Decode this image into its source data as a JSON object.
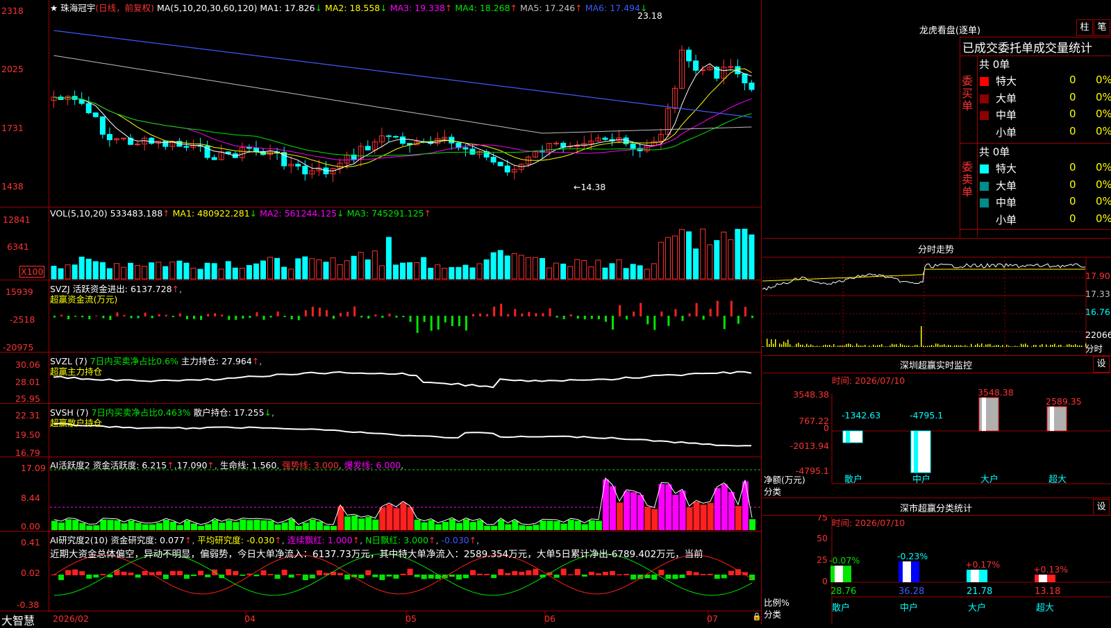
{
  "app": {
    "name": "大智慧"
  },
  "stock": {
    "star": "★",
    "name": "珠海冠宇",
    "mode": "(日线，前复权)"
  },
  "main": {
    "ma_label": "MA(5,10,20,30,60,120)",
    "ma": [
      {
        "label": "MA1:",
        "value": "17.826",
        "arrow": "↓",
        "color": "#ffffff"
      },
      {
        "label": "MA2:",
        "value": "18.558",
        "arrow": "↓",
        "color": "#ffff00"
      },
      {
        "label": "MA3:",
        "value": "19.338",
        "arrow": "↑",
        "color": "#ff00ff"
      },
      {
        "label": "MA4:",
        "value": "18.268",
        "arrow": "↑",
        "color": "#00e600"
      },
      {
        "label": "MA5:",
        "value": "17.246",
        "arrow": "↑",
        "color": "#c0c0c0"
      },
      {
        "label": "MA6:",
        "value": "17.494",
        "arrow": "↓",
        "color": "#3c5aff"
      }
    ],
    "y_ticks": [
      "2318",
      "2025",
      "1731",
      "1438"
    ],
    "high_note": "23.18",
    "low_note": "←14.38"
  },
  "vol": {
    "label": "VOL(5,10,20)",
    "value": "533483.188",
    "arrow": "↑",
    "ma": [
      {
        "label": "MA1:",
        "value": "480922.281",
        "arrow": "↓",
        "color": "#ffff00"
      },
      {
        "label": "MA2:",
        "value": "561244.125",
        "arrow": "↓",
        "color": "#ff00ff"
      },
      {
        "label": "MA3:",
        "value": "745291.125",
        "arrow": "↑",
        "color": "#00e600"
      }
    ],
    "y_ticks": [
      "12841",
      "6341",
      "X100"
    ]
  },
  "svzj": {
    "label": "SVZJ",
    "desc": "活跃资金进出:",
    "value": "6137.728",
    "arrow": "↑",
    "sub": "超赢资金流(万元)",
    "y_ticks": [
      "15939",
      "-2518",
      "-20975"
    ]
  },
  "svzl": {
    "label": "SVZL (7)",
    "desc": "7日内买卖净占比0.6%",
    "desc2": "主力持仓:",
    "value": "27.964",
    "arrow": "↑",
    "sub": "超赢主力持仓",
    "y_ticks": [
      "30.06",
      "28.01",
      "25.95"
    ]
  },
  "svsh": {
    "label": "SVSH (7)",
    "desc": "7日内买卖净占比0.463%",
    "desc2": "散户持仓:",
    "value": "17.255",
    "arrow": "↓",
    "sub": "超赢散户持仓",
    "y_ticks": [
      "22.31",
      "19.50",
      "16.79"
    ]
  },
  "ai1": {
    "label": "AI活跃度2",
    "desc": "资金活跃度:",
    "value": "6.215",
    "v2": "17.090",
    "life_label": "生命线:",
    "life": "1.560",
    "strong_label": "强势线:",
    "strong": "3.000",
    "burst_label": "爆发线:",
    "burst": "6.000",
    "y_ticks": [
      "17.09",
      "8.44",
      "0.00"
    ]
  },
  "ai2": {
    "label": "AI研究度2(10)",
    "desc": "资金研究度:",
    "value": "0.077",
    "avg_label": "平均研究度:",
    "avg": "-0.030",
    "lx_label": "连续飘红:",
    "lx": "1.000",
    "n_label": "N日飘红:",
    "n": "3.000",
    "last": "-0.030",
    "comment": "近期大资金总体偏空，异动不明显，偏弱势，今日大单净流入：6137.73万元，其中特大单净流入：2589.354万元，大单5日累计净出-6789.402万元，当前",
    "y_ticks": [
      "0.41",
      "0.02",
      "-0.38"
    ]
  },
  "xaxis": [
    "2026/02",
    "04",
    "05",
    "06",
    "07"
  ],
  "lhb": {
    "title": "龙虎看盘(逐单)",
    "btn_a": "柱",
    "btn_b": "笔",
    "header": "已成交委托单成交量统计",
    "buy_label": "委买单",
    "sell_label": "委卖单",
    "total": "共 0单",
    "rows": [
      {
        "name": "特大",
        "qty": "0",
        "pct": "0%"
      },
      {
        "name": "大单",
        "qty": "0",
        "pct": "0%"
      },
      {
        "name": "中单",
        "qty": "0",
        "pct": "0%"
      },
      {
        "name": "小单",
        "qty": "0",
        "pct": "0%"
      }
    ]
  },
  "fenshi": {
    "title": "分时走势",
    "y": [
      "17.90",
      "17.33",
      "16.76",
      "22066",
      "分时"
    ]
  },
  "monitor": {
    "title": "深圳超赢实时监控",
    "btn": "设",
    "time": "时间: 2026/07/10",
    "y": [
      "3548.38",
      "767.22",
      "0",
      "-2013.94",
      "-4795.1"
    ],
    "unit": "净额(万元)",
    "cat_label": "分类",
    "bars": [
      {
        "name": "散户",
        "value": -1342.63,
        "label": "-1342.63"
      },
      {
        "name": "中户",
        "value": -4795.1,
        "label": "-4795.1"
      },
      {
        "name": "大户",
        "value": 3548.38,
        "label": "3548.38"
      },
      {
        "name": "超大",
        "value": 2589.35,
        "label": "2589.35"
      }
    ]
  },
  "classify": {
    "title": "深市超赢分类统计",
    "btn": "设",
    "time": "时间: 2026/07/10",
    "y": [
      "75",
      "50",
      "25",
      "0"
    ],
    "unit": "比例%",
    "cat_label": "分类",
    "bars": [
      {
        "name": "散户",
        "value": 28.76,
        "pct": "-0.07%",
        "label": "28.76"
      },
      {
        "name": "中户",
        "value": 36.28,
        "pct": "-0.23%",
        "label": "36.28"
      },
      {
        "name": "大户",
        "value": 21.78,
        "pct": "+0.17%",
        "label": "21.78"
      },
      {
        "name": "超大",
        "value": 13.18,
        "pct": "+0.13%",
        "label": "13.18"
      }
    ]
  }
}
